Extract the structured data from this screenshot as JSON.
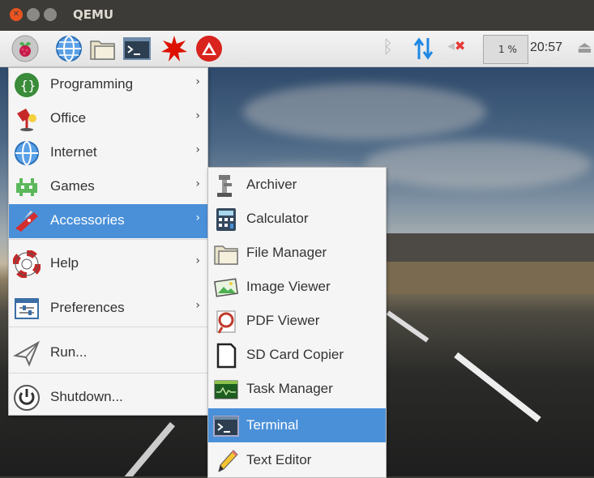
{
  "window": {
    "title": "QEMU"
  },
  "taskbar": {
    "launchers": [
      {
        "name": "raspberry-menu",
        "icon": "raspberry-icon"
      },
      {
        "name": "web-browser",
        "icon": "globe-icon"
      },
      {
        "name": "file-manager",
        "icon": "folder-icon"
      },
      {
        "name": "terminal",
        "icon": "terminal-icon"
      },
      {
        "name": "wolfram",
        "icon": "wolfram-icon"
      },
      {
        "name": "mathematica",
        "icon": "mathematica-icon"
      }
    ],
    "tray": {
      "bluetooth_icon": "bluetooth-icon",
      "network_icon": "network-arrows-icon",
      "volume_icon": "volume-muted-icon",
      "cpu_usage": "1 %",
      "clock": "20:57",
      "eject_icon": "eject-icon"
    }
  },
  "menu": {
    "items": [
      {
        "label": "Programming",
        "icon": "programming-icon",
        "submenu": true
      },
      {
        "label": "Office",
        "icon": "office-icon",
        "submenu": true
      },
      {
        "label": "Internet",
        "icon": "globe-icon",
        "submenu": true
      },
      {
        "label": "Games",
        "icon": "games-icon",
        "submenu": true
      },
      {
        "label": "Accessories",
        "icon": "accessories-icon",
        "submenu": true,
        "active": true
      },
      {
        "label": "Help",
        "icon": "help-lifebuoy-icon",
        "submenu": true
      },
      {
        "label": "Preferences",
        "icon": "preferences-icon",
        "submenu": true
      },
      {
        "label": "Run...",
        "icon": "run-paperplane-icon",
        "submenu": false
      },
      {
        "label": "Shutdown...",
        "icon": "power-icon",
        "submenu": false
      }
    ]
  },
  "submenu": {
    "items": [
      {
        "label": "Archiver",
        "icon": "archiver-icon"
      },
      {
        "label": "Calculator",
        "icon": "calculator-icon"
      },
      {
        "label": "File Manager",
        "icon": "folder-icon"
      },
      {
        "label": "Image Viewer",
        "icon": "image-viewer-icon"
      },
      {
        "label": "PDF Viewer",
        "icon": "pdf-viewer-icon"
      },
      {
        "label": "SD Card Copier",
        "icon": "sd-card-icon"
      },
      {
        "label": "Task Manager",
        "icon": "task-manager-icon"
      },
      {
        "label": "Terminal",
        "icon": "terminal-icon",
        "active": true
      },
      {
        "label": "Text Editor",
        "icon": "text-editor-icon"
      }
    ]
  },
  "colors": {
    "highlight": "#4a90d9",
    "menu_bg": "#f5f5f5",
    "titlebar": "#3c3b37",
    "close": "#e95420"
  }
}
